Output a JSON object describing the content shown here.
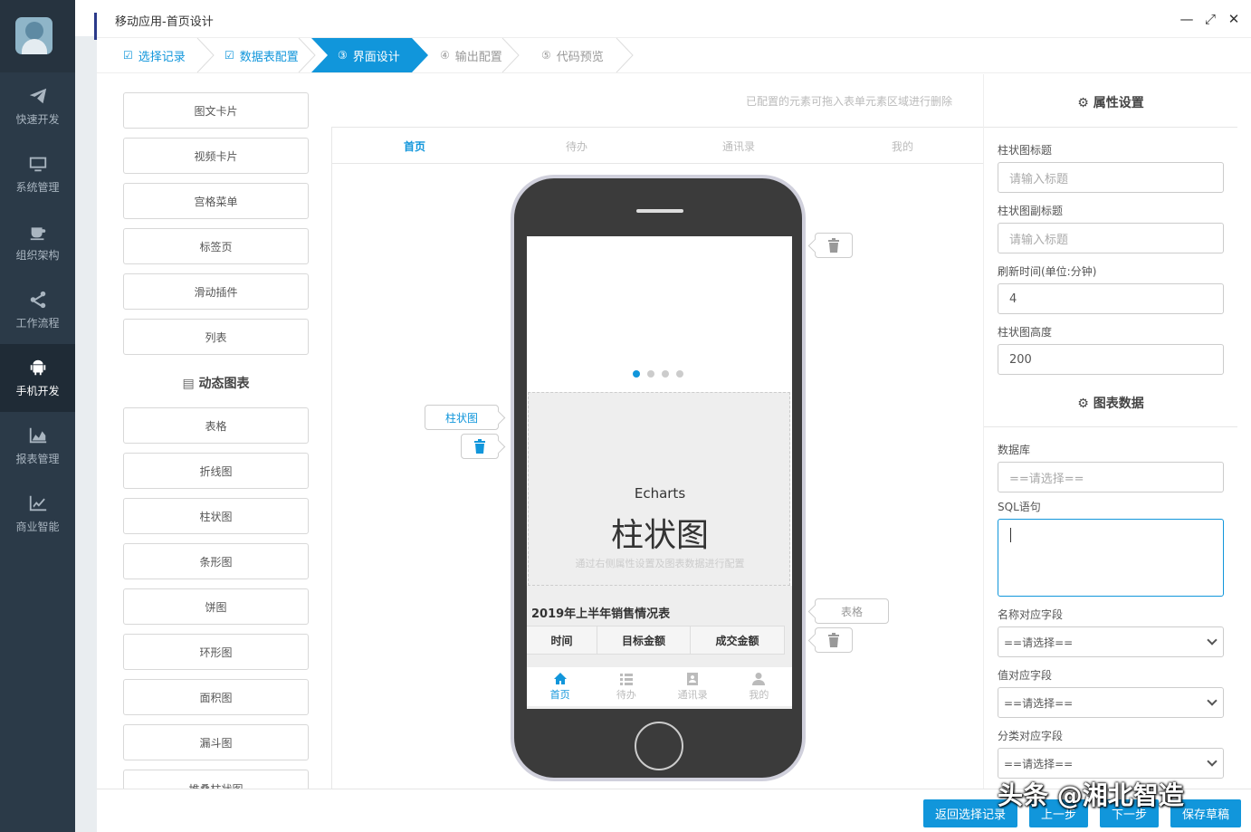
{
  "sidebar": {
    "items": [
      {
        "label": "快速开发",
        "icon": "paper-plane-icon"
      },
      {
        "label": "系统管理",
        "icon": "monitor-icon"
      },
      {
        "label": "组织架构",
        "icon": "coffee-cup-icon"
      },
      {
        "label": "工作流程",
        "icon": "share-icon"
      },
      {
        "label": "手机开发",
        "icon": "android-icon",
        "active": true
      },
      {
        "label": "报表管理",
        "icon": "area-chart-icon"
      },
      {
        "label": "商业智能",
        "icon": "line-chart-icon"
      }
    ]
  },
  "dialog": {
    "title": "移动应用-首页设计",
    "controls": {
      "minimize": "—",
      "maximize": "⤢",
      "close": "✕"
    }
  },
  "steps": [
    {
      "label": "选择记录",
      "mark": "☑",
      "state": "done"
    },
    {
      "label": "数据表配置",
      "mark": "☑",
      "state": "done"
    },
    {
      "label": "界面设计",
      "mark": "③",
      "state": "active"
    },
    {
      "label": "输出配置",
      "mark": "④",
      "state": "todo"
    },
    {
      "label": "代码预览",
      "mark": "⑤",
      "state": "todo"
    }
  ],
  "components": {
    "basic": [
      "图文卡片",
      "视频卡片",
      "宫格菜单",
      "标签页",
      "滑动插件",
      "列表"
    ],
    "chart_group_title": "动态图表",
    "charts": [
      "表格",
      "折线图",
      "柱状图",
      "条形图",
      "饼图",
      "环形图",
      "面积图",
      "漏斗图",
      "堆叠柱状图"
    ]
  },
  "design": {
    "hint": "已配置的元素可拖入表单元素区域进行删除",
    "tabs": [
      "首页",
      "待办",
      "通讯录",
      "我的"
    ],
    "echarts": {
      "small": "Echarts",
      "big": "柱状图",
      "desc": "通过右侧属性设置及图表数据进行配置"
    },
    "table": {
      "title": "2019年上半年销售情况表",
      "headers": [
        "时间",
        "目标金额",
        "成交金额"
      ]
    },
    "phone_nav": [
      {
        "label": "首页",
        "icon": "home-icon"
      },
      {
        "label": "待办",
        "icon": "list-icon"
      },
      {
        "label": "通讯录",
        "icon": "contacts-icon"
      },
      {
        "label": "我的",
        "icon": "user-icon"
      }
    ],
    "bubbles": {
      "bar_chart": "柱状图",
      "table": "表格"
    }
  },
  "props": {
    "title": "属性设置",
    "fields": {
      "bar_title_label": "柱状图标题",
      "bar_title_placeholder": "请输入标题",
      "bar_subtitle_label": "柱状图副标题",
      "bar_subtitle_placeholder": "请输入标题",
      "refresh_label": "刷新时间(单位:分钟)",
      "refresh_value": "4",
      "height_label": "柱状图高度",
      "height_value": "200"
    },
    "data_title": "图表数据",
    "data_fields": {
      "db_label": "数据库",
      "db_placeholder": "==请选择==",
      "sql_label": "SQL语句",
      "name_label": "名称对应字段",
      "name_value": "==请选择==",
      "value_label": "值对应字段",
      "value_value": "==请选择==",
      "category_label": "分类对应字段",
      "category_value": "==请选择=="
    }
  },
  "footer": {
    "buttons": [
      "返回选择记录",
      "上一步",
      "下一步",
      "保存草稿"
    ]
  },
  "watermark": "头条 @湘北智造",
  "colors": {
    "accent": "#1196db",
    "sidebar": "#2b3a48"
  }
}
